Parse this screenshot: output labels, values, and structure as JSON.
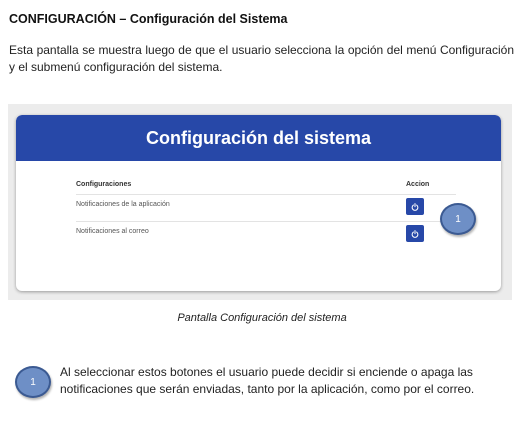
{
  "document": {
    "heading": "CONFIGURACIÓN – Configuración del Sistema",
    "intro": "Esta pantalla se muestra luego de que el usuario selecciona la opción del menú Configuración y el submenú configuración del sistema.",
    "caption": "Pantalla Configuración del sistema",
    "note": {
      "badge": "1",
      "text": "Al seleccionar estos botones el usuario puede decidir si enciende o apaga las notificaciones que serán enviadas, tanto por la aplicación, como por el correo."
    }
  },
  "screenshot": {
    "title": "Configuración del sistema",
    "columns": {
      "left": "Configuraciones",
      "right": "Accion"
    },
    "rows": [
      {
        "label": "Notificaciones de la aplicación",
        "action_icon": "power-icon"
      },
      {
        "label": "Notificaciones al correo",
        "action_icon": "power-icon"
      }
    ],
    "callout_badge": "1",
    "colors": {
      "header": "#2748a8",
      "button": "#2748a8",
      "badge": "#6e8fc6"
    }
  }
}
